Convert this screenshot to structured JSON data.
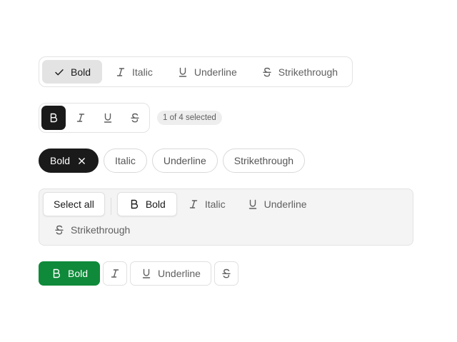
{
  "colors": {
    "selected_dark": "#1a1a1a",
    "selected_green": "#0f8a3a",
    "selected_gray": "#e3e3e3",
    "text_muted": "#5f5f5f",
    "border": "#e3e3e3"
  },
  "group1": {
    "items": [
      {
        "label": "Bold",
        "icon": "check-icon",
        "selected": true
      },
      {
        "label": "Italic",
        "icon": "italic-icon",
        "selected": false
      },
      {
        "label": "Underline",
        "icon": "underline-icon",
        "selected": false
      },
      {
        "label": "Strikethrough",
        "icon": "strikethrough-icon",
        "selected": false
      }
    ]
  },
  "group2": {
    "items": [
      {
        "icon": "bold-icon",
        "selected": true
      },
      {
        "icon": "italic-icon",
        "selected": false
      },
      {
        "icon": "underline-icon",
        "selected": false
      },
      {
        "icon": "strikethrough-icon",
        "selected": false
      }
    ],
    "count_label": "1 of 4 selected"
  },
  "group3": {
    "items": [
      {
        "label": "Bold",
        "selected": true,
        "remove_icon": "close-icon"
      },
      {
        "label": "Italic",
        "selected": false
      },
      {
        "label": "Underline",
        "selected": false
      },
      {
        "label": "Strikethrough",
        "selected": false
      }
    ]
  },
  "group4": {
    "select_all_label": "Select all",
    "items": [
      {
        "label": "Bold",
        "icon": "bold-icon",
        "selected": true
      },
      {
        "label": "Italic",
        "icon": "italic-icon",
        "selected": false
      },
      {
        "label": "Underline",
        "icon": "underline-icon",
        "selected": false
      },
      {
        "label": "Strikethrough",
        "icon": "strikethrough-icon",
        "selected": false
      }
    ]
  },
  "group5": {
    "items": [
      {
        "label": "Bold",
        "icon": "bold-icon",
        "selected": true
      },
      {
        "label": "",
        "icon": "italic-icon",
        "selected": false
      },
      {
        "label": "Underline",
        "icon": "underline-icon",
        "selected": false
      },
      {
        "label": "",
        "icon": "strikethrough-icon",
        "selected": false
      }
    ]
  }
}
